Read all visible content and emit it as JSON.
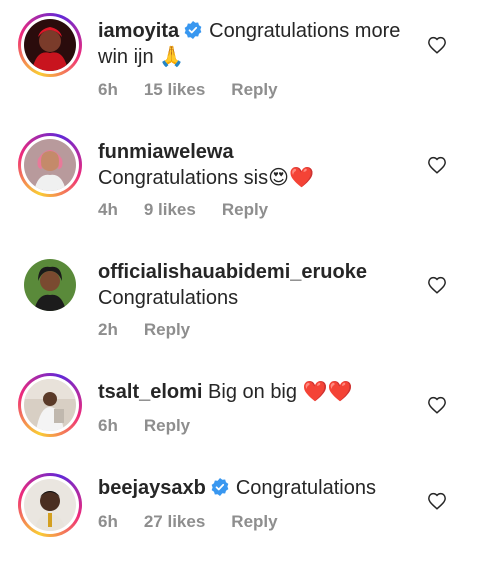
{
  "comments": [
    {
      "username": "iamoyita",
      "verified": true,
      "text": "Congratulations more win ijn 🙏",
      "time": "6h",
      "likes": "15 likes",
      "reply": "Reply"
    },
    {
      "username": "funmiawelewa",
      "verified": false,
      "text": "Congratulations sis😍❤️",
      "time": "4h",
      "likes": "9 likes",
      "reply": "Reply"
    },
    {
      "username": "officialishauabidemi_eruoke",
      "verified": false,
      "text": "Congratulations",
      "time": "2h",
      "likes": "",
      "reply": "Reply"
    },
    {
      "username": "tsalt_elomi",
      "verified": false,
      "text": "Big on big ❤️❤️",
      "time": "6h",
      "likes": "",
      "reply": "Reply"
    },
    {
      "username": "beejaysaxb",
      "verified": true,
      "text": "Congratulations",
      "time": "6h",
      "likes": "27 likes",
      "reply": "Reply"
    }
  ],
  "colors": {
    "verified": "#3897f0",
    "meta": "#8e8e8e",
    "heart_red": "#ed4956"
  },
  "icons": {
    "like": "heart-outline-icon",
    "verified": "verified-badge-icon"
  }
}
